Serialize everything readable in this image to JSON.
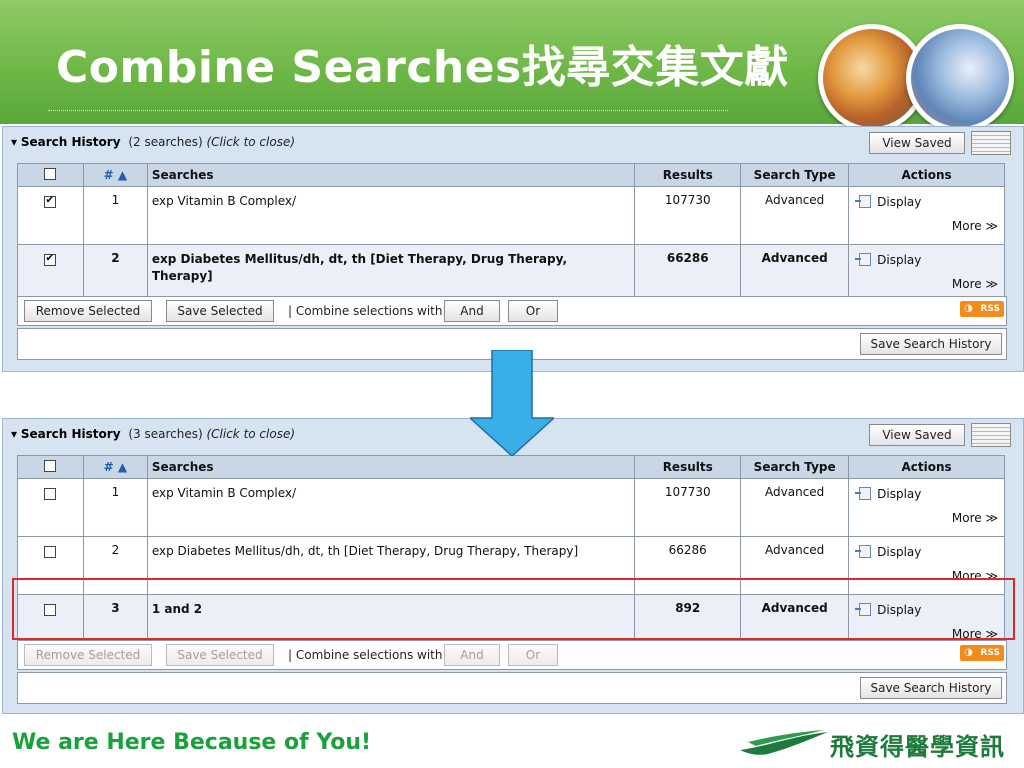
{
  "slide": {
    "title": "Combine Searches找尋交集文獻",
    "tagline": "We are Here Because of You!",
    "logo_text": "飛資得醫學資訊"
  },
  "panels": [
    {
      "title": "Search History",
      "count": "(2 searches)",
      "click_hint": "(Click to close)",
      "view_saved": "View Saved",
      "headers": [
        "",
        "# ▲",
        "Searches",
        "Results",
        "Search Type",
        "Actions"
      ],
      "rows": [
        {
          "checked": true,
          "num": "1",
          "search": "exp Vitamin B Complex/",
          "results": "107730",
          "type": "Advanced",
          "display": "Display",
          "more": "More ≫",
          "bold": false
        },
        {
          "checked": true,
          "num": "2",
          "search": "exp Diabetes Mellitus/dh, dt, th [Diet Therapy, Drug Therapy, Therapy]",
          "results": "66286",
          "type": "Advanced",
          "display": "Display",
          "more": "More ≫",
          "bold": true
        }
      ],
      "remove_selected": "Remove Selected",
      "save_selected": "Save Selected",
      "combine_label": "| Combine selections with:",
      "and_label": "And",
      "or_label": "Or",
      "rss_label": "RSS",
      "save_history": "Save Search History"
    },
    {
      "title": "Search History",
      "count": "(3 searches)",
      "click_hint": "(Click to close)",
      "view_saved": "View Saved",
      "headers": [
        "",
        "# ▲",
        "Searches",
        "Results",
        "Search Type",
        "Actions"
      ],
      "rows": [
        {
          "checked": false,
          "num": "1",
          "search": "exp Vitamin B Complex/",
          "results": "107730",
          "type": "Advanced",
          "display": "Display",
          "more": "More ≫",
          "bold": false
        },
        {
          "checked": false,
          "num": "2",
          "search": "exp Diabetes Mellitus/dh, dt, th [Diet Therapy, Drug Therapy, Therapy]",
          "results": "66286",
          "type": "Advanced",
          "display": "Display",
          "more": "More ≫",
          "bold": false
        },
        {
          "checked": false,
          "num": "3",
          "search": "1 and 2",
          "results": "892",
          "type": "Advanced",
          "display": "Display",
          "more": "More ≫",
          "bold": true
        }
      ],
      "remove_selected": "Remove Selected",
      "save_selected": "Save Selected",
      "combine_label": "| Combine selections with:",
      "and_label": "And",
      "or_label": "Or",
      "rss_label": "RSS",
      "save_history": "Save Search History"
    }
  ],
  "colors": {
    "banner": "#6fb848",
    "highlight": "#d92b2b",
    "arrow": "#3aaee6",
    "tagline": "#19a13a"
  }
}
